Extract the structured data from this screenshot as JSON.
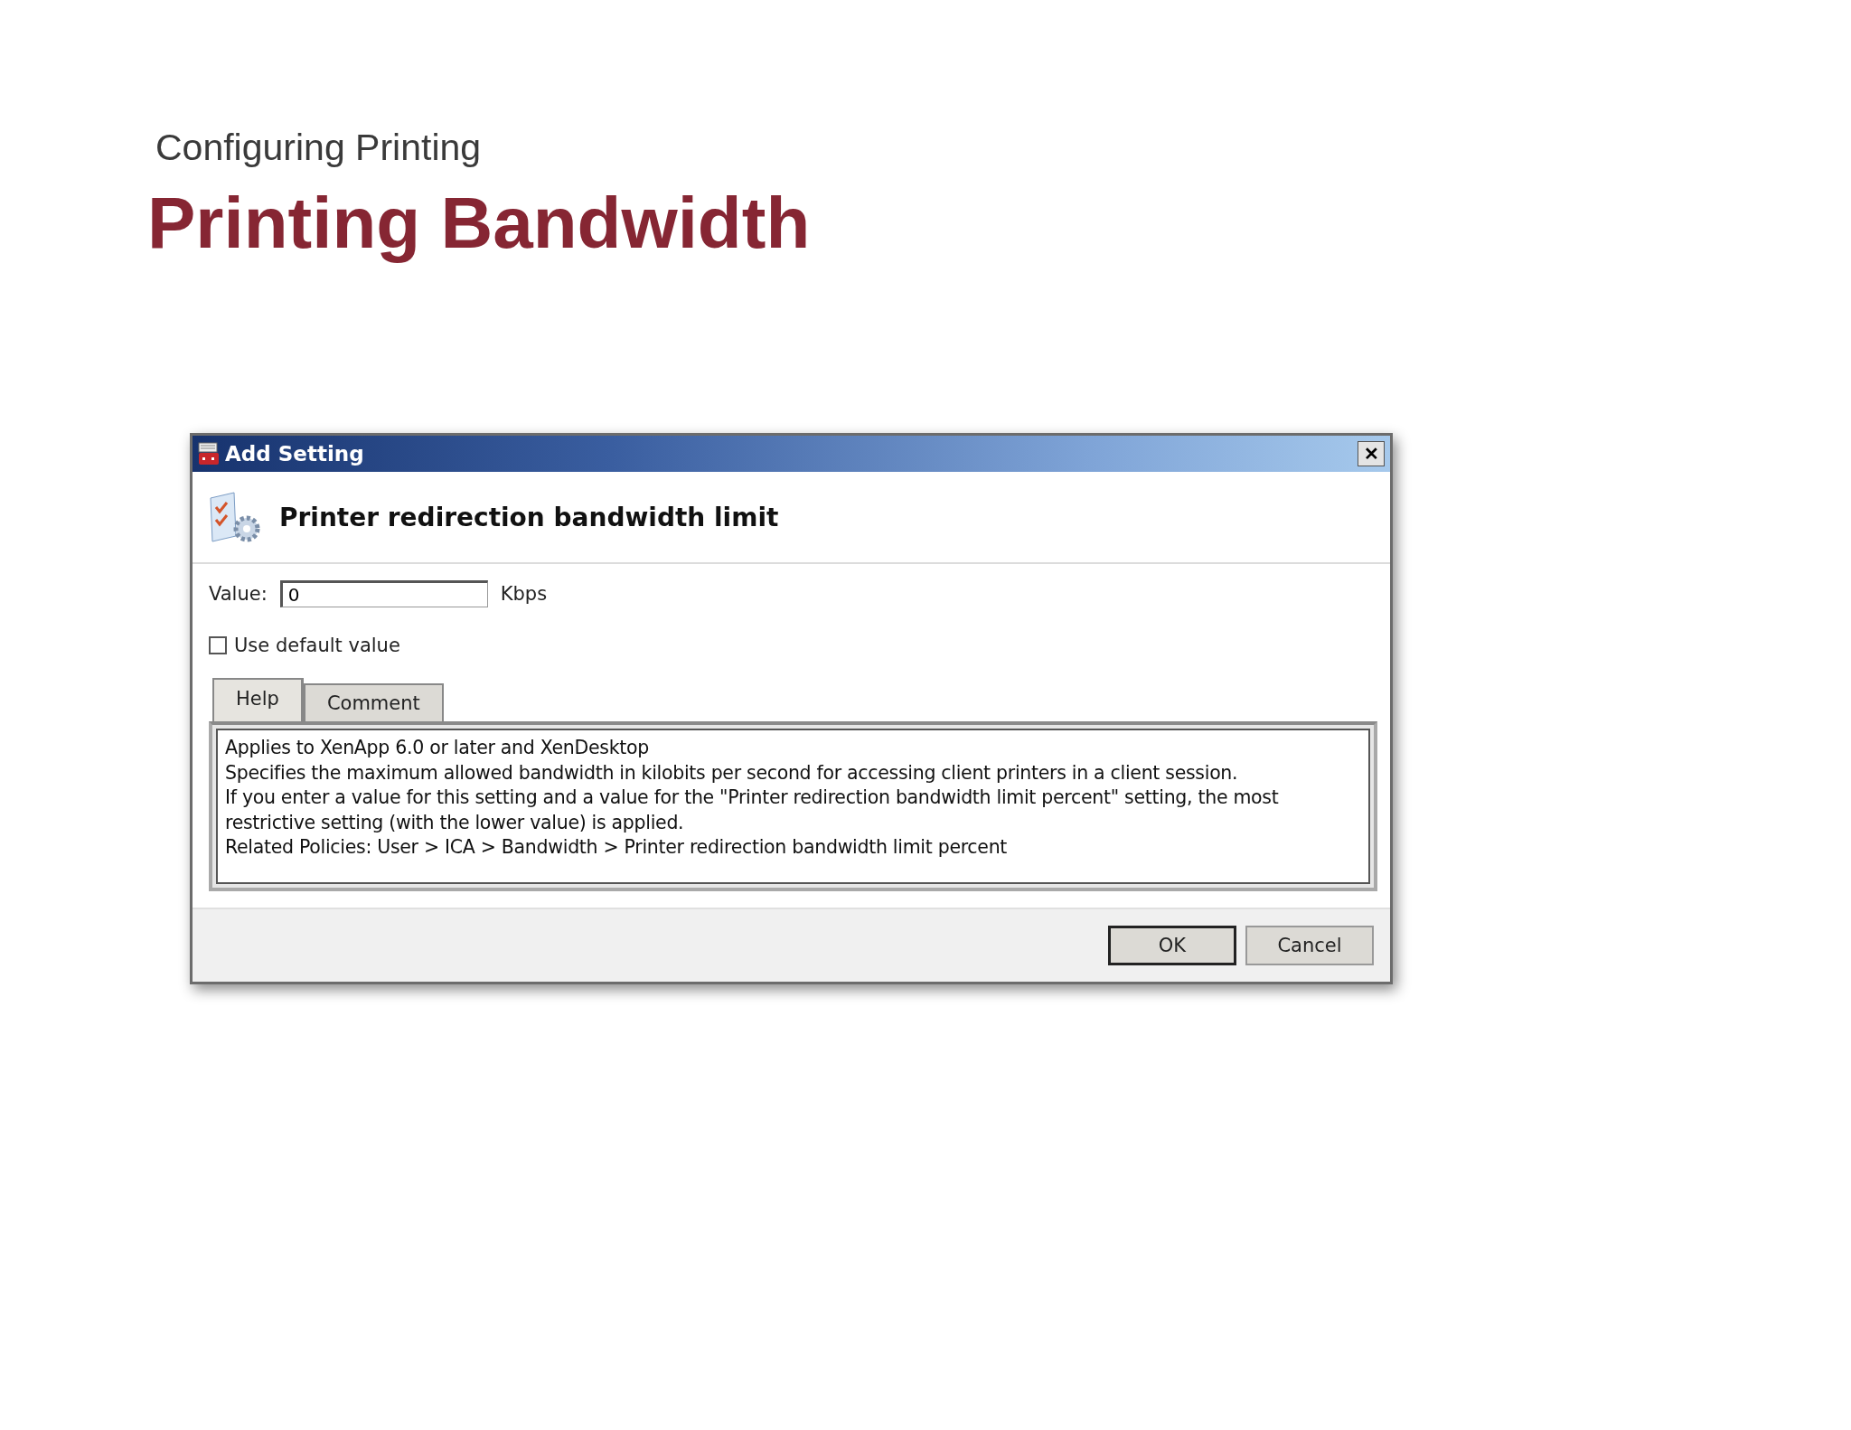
{
  "slide": {
    "section": "Configuring Printing",
    "title": "Printing Bandwidth"
  },
  "dialog": {
    "title": "Add Setting",
    "close": "✕",
    "heading": "Printer redirection bandwidth limit",
    "value_label": "Value:",
    "value": "0",
    "unit": "Kbps",
    "use_default": {
      "label": "Use default value",
      "checked": false
    },
    "tabs": [
      {
        "label": "Help",
        "selected": true
      },
      {
        "label": "Comment",
        "selected": false
      }
    ],
    "help_lines": [
      "Applies to XenApp 6.0 or later and XenDesktop",
      "Specifies the maximum allowed bandwidth in kilobits per second for accessing client printers in a client session.",
      "If you enter a value for this setting and a value for the \"Printer redirection bandwidth limit percent\" setting, the most",
      "restrictive setting (with the lower value) is applied.",
      "Related Policies: User > ICA > Bandwidth > Printer redirection bandwidth limit percent"
    ],
    "buttons": [
      {
        "label": "OK",
        "default": true
      },
      {
        "label": "Cancel",
        "default": false
      }
    ]
  }
}
